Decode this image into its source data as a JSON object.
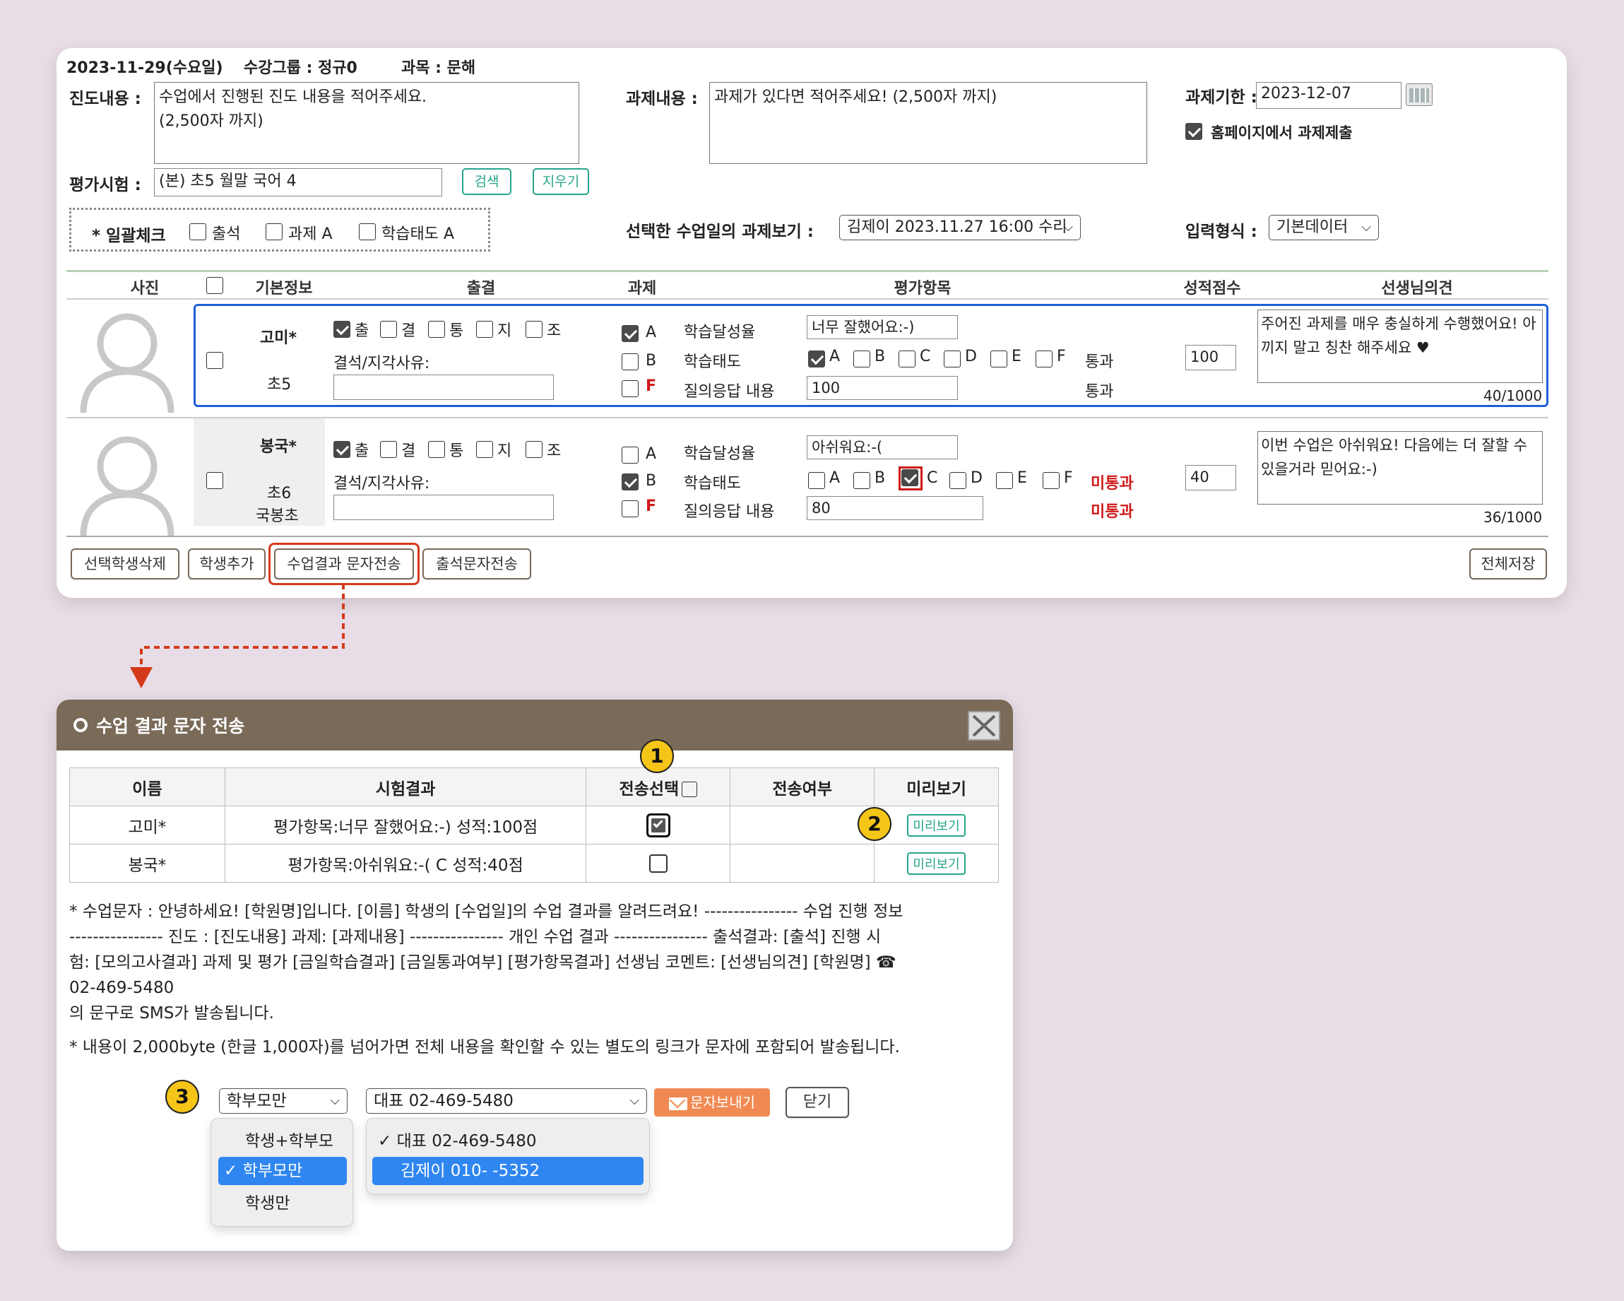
{
  "header": {
    "date": "2023-11-29(수요일)",
    "group": "수강그룹 : 정규0",
    "subject": "과목 : 문해"
  },
  "progress": {
    "label": "진도내용 :",
    "placeholder_line1": "수업에서 진행된 진도 내용을 적어주세요.",
    "placeholder_line2": "(2,500자 까지)"
  },
  "assignment": {
    "label": "과제내용 :",
    "placeholder": "과제가 있다면 적어주세요! (2,500자 까지)"
  },
  "deadline": {
    "label": "과제기한 :",
    "value": "2023-12-07",
    "submit_label": "홈페이지에서 과제제출"
  },
  "exam": {
    "label": "평가시험 :",
    "value": "(본) 초5 월말 국어 4",
    "search": "검색",
    "clear": "지우기"
  },
  "bulk": {
    "label": "* 일괄체크",
    "attend": "출석",
    "homework": "과제 A",
    "attitude": "학습태도 A"
  },
  "view_hw": {
    "label": "선택한 수업일의 과제보기 :",
    "value": "김제이 2023.11.27 16:00 수리"
  },
  "input_type": {
    "label": "입력형식 :",
    "value": "기본데이터"
  },
  "columns": [
    "사진",
    "기본정보",
    "출결",
    "과제",
    "평가항목",
    "성적점수",
    "선생님의견"
  ],
  "students": [
    {
      "name": "고미*",
      "grade": "초5",
      "school": "",
      "att": [
        "출",
        "결",
        "통",
        "지",
        "조"
      ],
      "reason_label": "결석/지각사유:",
      "hw": [
        "A",
        "B",
        "F"
      ],
      "items": [
        "학습달성율",
        "학습태도",
        "질의응답 내용"
      ],
      "achieve": "너무 잘했어요:-)",
      "grades": [
        "A",
        "B",
        "C",
        "D",
        "E",
        "F"
      ],
      "pass1": "통과",
      "pass2": "통과",
      "qa": "100",
      "score": "100",
      "comment": "주어진 과제를 매우 충실하게 수행했어요! 아끼지 말고 칭찬 해주세요 ♥",
      "count": "40/1000"
    },
    {
      "name": "봉국*",
      "grade": "초6",
      "school": "국봉초",
      "att": [
        "출",
        "결",
        "통",
        "지",
        "조"
      ],
      "reason_label": "결석/지각사유:",
      "hw": [
        "A",
        "B",
        "F"
      ],
      "items": [
        "학습달성율",
        "학습태도",
        "질의응답 내용"
      ],
      "achieve": "아쉬워요:-(",
      "grades": [
        "A",
        "B",
        "C",
        "D",
        "E",
        "F"
      ],
      "pass1": "미통과",
      "pass2": "미통과",
      "qa": "80",
      "score": "40",
      "comment": "이번 수업은 아쉬워요! 다음에는 더 잘할 수 있을거라 믿어요:-)",
      "count": "36/1000"
    }
  ],
  "actions": {
    "delete": "선택학생삭제",
    "add": "학생추가",
    "sms_result": "수업결과 문자전송",
    "sms_attend": "출석문자전송",
    "save_all": "전체저장"
  },
  "modal": {
    "title": "수업 결과 문자 전송",
    "th": [
      "이름",
      "시험결과",
      "전송선택",
      "전송여부",
      "미리보기"
    ],
    "rows": [
      {
        "name": "고미*",
        "result": "평가항목:너무 잘했어요:-) 성적:100점",
        "preview": "미리보기"
      },
      {
        "name": "봉국*",
        "result": "평가항목:아쉬워요:-( C 성적:40점",
        "preview": "미리보기"
      }
    ],
    "note1_l1": "* 수업문자 : 안녕하세요! [학원명]입니다. [이름] 학생의 [수업일]의 수업 결과를 알려드려요! ---------------- 수업 진행 정보",
    "note1_l2": "---------------- 진도 : [진도내용] 과제: [과제내용] ---------------- 개인 수업 결과 ---------------- 출석결과: [출석] 진행 시",
    "note1_l3": "험: [모의고사결과] 과제 및 평가 [금일학습결과] [금일통과여부] [평가항목결과] 선생님 코멘트: [선생님의견] [학원명] ☎",
    "note1_l4": "02-469-5480",
    "note1_l5": "의 문구로 SMS가 발송됩니다.",
    "note2": "* 내용이 2,000byte (한글 1,000자)를 넘어가면 전체 내용을 확인할 수 있는 별도의 링크가 문자에 포함되어 발송됩니다.",
    "recipient": "학부모만",
    "sender": "대표 02-469-5480",
    "send": "문자보내기",
    "close": "닫기",
    "recipient_options": [
      "학생+학부모",
      "학부모만",
      "학생만"
    ],
    "sender_options": [
      "대표 02-469-5480",
      "김제이 010-        -5352"
    ]
  },
  "badges": [
    "1",
    "2",
    "3"
  ],
  "colors": {
    "accent_blue": "#1f5fd6",
    "accent_red": "#d43a1a",
    "modal_header": "#7a6a58",
    "green": "#27a58a",
    "badge": "#f5c518"
  }
}
